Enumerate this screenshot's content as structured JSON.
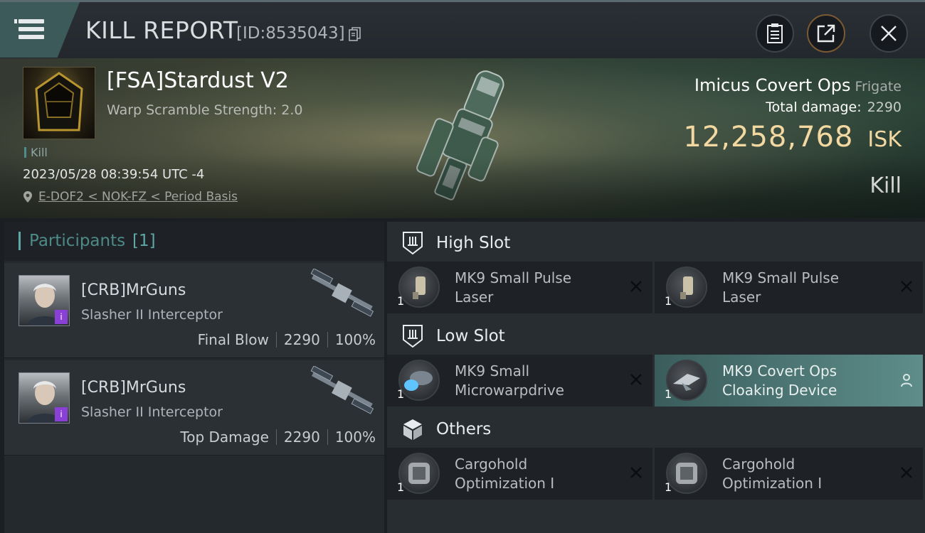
{
  "header": {
    "title": "KILL REPORT",
    "report_id": "[ID:8535043]",
    "icons": {
      "menu": "hamburger-menu-icon",
      "copy": "copy-icon",
      "clipboard": "clipboard-icon",
      "share": "share-icon",
      "close": "close-icon"
    }
  },
  "victim": {
    "pilot_name": "[FSA]Stardust V2",
    "warp_scramble": "Warp Scramble Strength: 2.0",
    "kill_tag": "Kill",
    "timestamp": "2023/05/28 08:39:54 UTC -4",
    "location": "E-DOF2 < NOK-FZ < Period Basis",
    "ship_name": "Imicus Covert Ops",
    "ship_class": "Frigate",
    "total_damage_label": "Total damage:",
    "total_damage": "2290",
    "isk_value": "12,258,768",
    "isk_unit": "ISK",
    "result": "Kill"
  },
  "participants": {
    "title": "Participants",
    "count": "[1]",
    "items": [
      {
        "name": "[CRB]MrGuns",
        "ship": "Slasher II Interceptor",
        "role": "Final Blow",
        "damage": "2290",
        "percent": "100%",
        "badge": "i"
      },
      {
        "name": "[CRB]MrGuns",
        "ship": "Slasher II Interceptor",
        "role": "Top Damage",
        "damage": "2290",
        "percent": "100%",
        "badge": "i"
      }
    ]
  },
  "fittings": {
    "high_slot": {
      "title": "High Slot",
      "modules": [
        {
          "name_line1": "MK9 Small Pulse",
          "name_line2": "Laser",
          "qty": "1",
          "status": "destroyed"
        },
        {
          "name_line1": "MK9 Small Pulse",
          "name_line2": "Laser",
          "qty": "1",
          "status": "destroyed"
        }
      ]
    },
    "low_slot": {
      "title": "Low Slot",
      "modules": [
        {
          "name_line1": "MK9 Small",
          "name_line2": "Microwarpdrive",
          "qty": "1",
          "status": "destroyed"
        },
        {
          "name_line1": "MK9 Covert Ops",
          "name_line2": "Cloaking Device",
          "qty": "1",
          "status": "dropped"
        }
      ]
    },
    "others": {
      "title": "Others",
      "modules": [
        {
          "name_line1": "Cargohold",
          "name_line2": "Optimization I",
          "qty": "1",
          "status": "destroyed"
        },
        {
          "name_line1": "Cargohold",
          "name_line2": "Optimization I",
          "qty": "1",
          "status": "destroyed"
        }
      ]
    }
  },
  "colors": {
    "accent_teal": "#5fa8a6",
    "isk_gold": "#f3d9a1",
    "highlight_module": "#5e8d8a",
    "badge_purple": "#8a3fd6"
  }
}
